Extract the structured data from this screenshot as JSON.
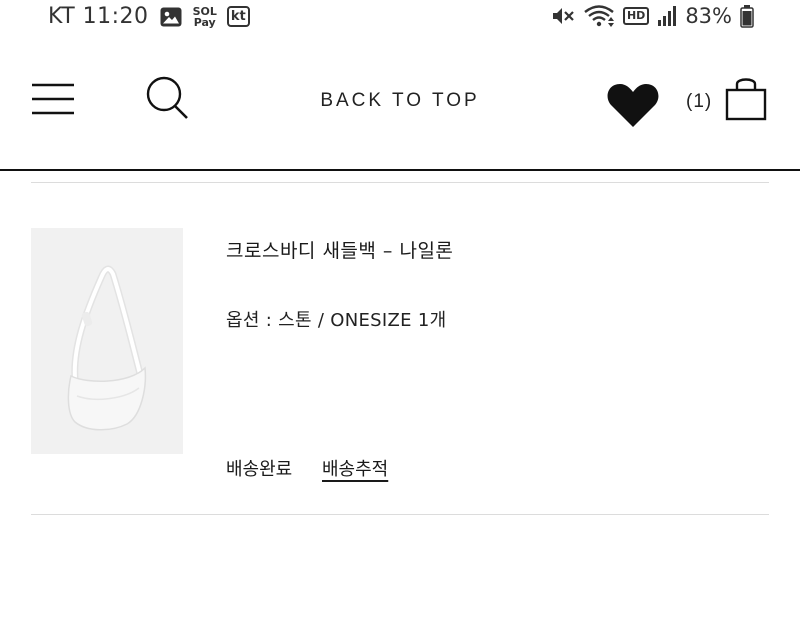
{
  "status_bar": {
    "carrier_time": "KT 11:20",
    "sol_pay_top": "SOL",
    "sol_pay_bottom": "Pay",
    "kt_badge": "kt",
    "hd_badge": "HD",
    "battery": "83%",
    "icons": [
      "gallery-icon",
      "sol-pay-icon",
      "kt-app-icon",
      "mute-icon",
      "wifi-icon",
      "hd-voice-icon",
      "signal-icon",
      "battery-icon"
    ]
  },
  "header": {
    "back_to_top": "BACK TO TOP",
    "cart_count": "(1)",
    "icons": [
      "hamburger-menu-icon",
      "search-icon",
      "heart-icon",
      "shopping-bag-icon"
    ]
  },
  "order_item": {
    "product_name": "크로스바디 새들백 – 나일론",
    "option": "옵션 : 스톤 / ONESIZE 1개",
    "delivery_status": "배송완료",
    "track_label": "배송추적",
    "thumbnail": "white-crossbody-bag-image"
  },
  "colors": {
    "text": "#1a1a1a",
    "divider": "#111111",
    "light_divider": "#dcdcdc",
    "thumb_bg": "#f1f1f1"
  }
}
